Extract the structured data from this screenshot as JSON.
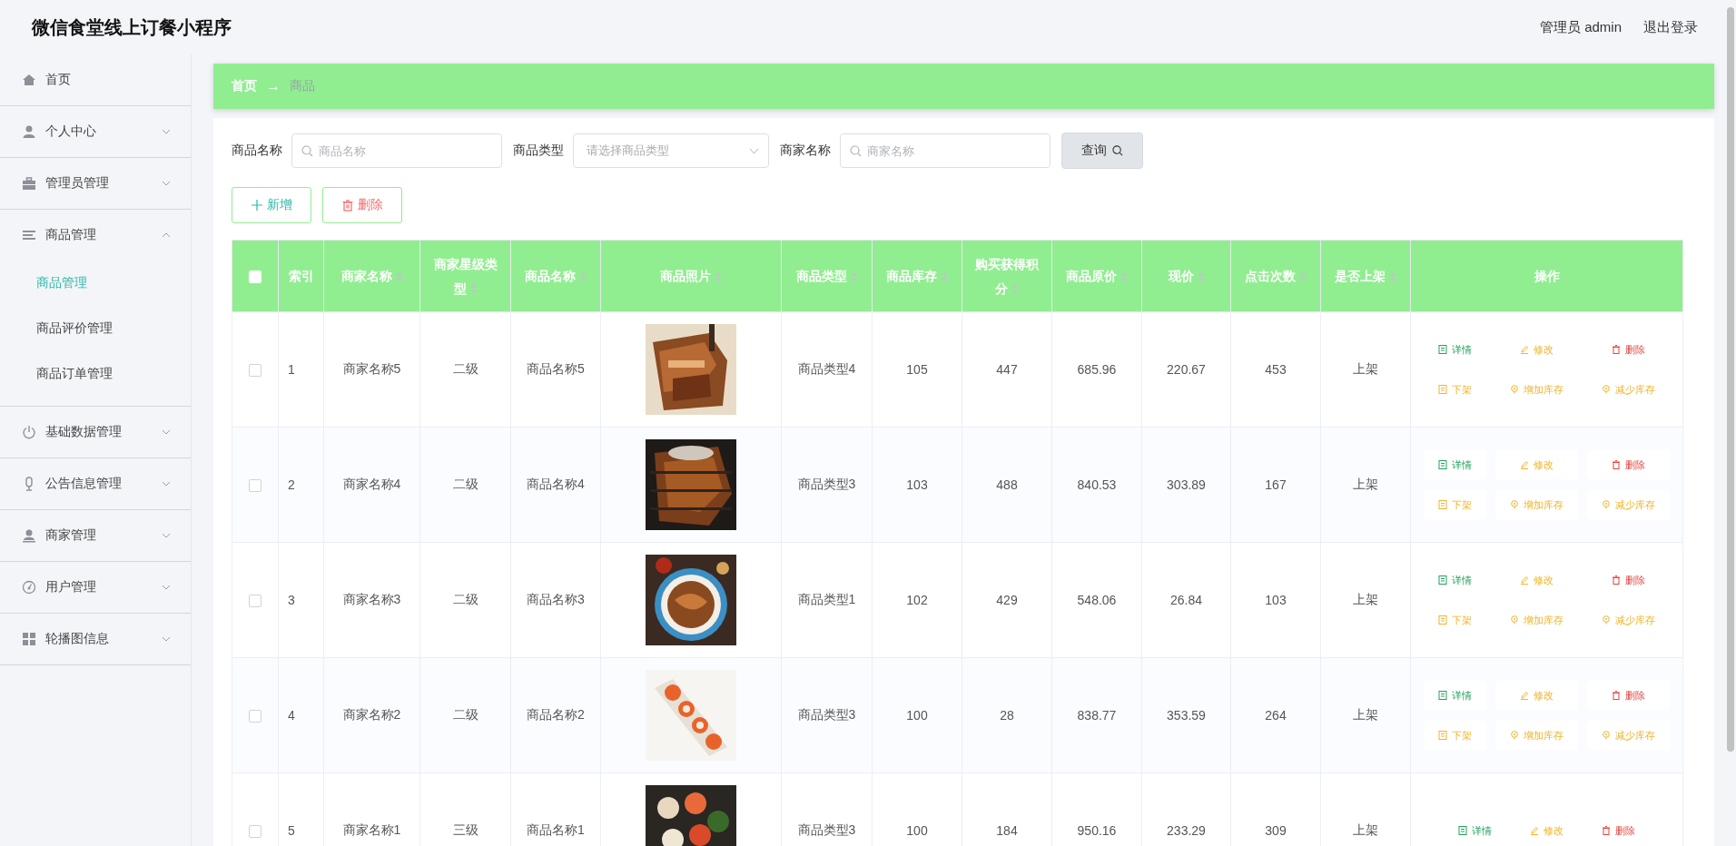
{
  "header": {
    "title": "微信食堂线上订餐小程序",
    "user": "管理员 admin",
    "logout": "退出登录"
  },
  "sidebar": {
    "items": [
      {
        "label": "首页",
        "expandable": false,
        "expanded": false
      },
      {
        "label": "个人中心",
        "expandable": true,
        "expanded": false
      },
      {
        "label": "管理员管理",
        "expandable": true,
        "expanded": false
      },
      {
        "label": "商品管理",
        "expandable": true,
        "expanded": true,
        "children": [
          {
            "label": "商品管理",
            "selected": true
          },
          {
            "label": "商品评价管理",
            "selected": false
          },
          {
            "label": "商品订单管理",
            "selected": false
          }
        ]
      },
      {
        "label": "基础数据管理",
        "expandable": true,
        "expanded": false
      },
      {
        "label": "公告信息管理",
        "expandable": true,
        "expanded": false
      },
      {
        "label": "商家管理",
        "expandable": true,
        "expanded": false
      },
      {
        "label": "用户管理",
        "expandable": true,
        "expanded": false
      },
      {
        "label": "轮播图信息",
        "expandable": true,
        "expanded": false
      }
    ]
  },
  "breadcrumb": {
    "items": [
      "首页",
      "商品"
    ],
    "separator": "→"
  },
  "search": {
    "fields": [
      {
        "label": "商品名称",
        "kind": "input",
        "placeholder": "商品名称"
      },
      {
        "label": "商品类型",
        "kind": "select",
        "placeholder": "请选择商品类型"
      },
      {
        "label": "商家名称",
        "kind": "input",
        "placeholder": "商家名称"
      }
    ],
    "button": "查询"
  },
  "toolbar": [
    {
      "label": "新增",
      "kind": "add"
    },
    {
      "label": "删除",
      "kind": "delete"
    }
  ],
  "table": {
    "columns": [
      {
        "kind": "checkbox",
        "checked": false
      },
      {
        "kind": "text",
        "label": "索引",
        "sortable": false
      },
      {
        "kind": "text",
        "label": "商家名称",
        "sortable": true
      },
      {
        "kind": "text",
        "label": "商家星级类型",
        "sortable": true
      },
      {
        "kind": "text",
        "label": "商品名称",
        "sortable": true
      },
      {
        "kind": "text",
        "label": "商品照片",
        "sortable": true
      },
      {
        "kind": "text",
        "label": "商品类型",
        "sortable": true
      },
      {
        "kind": "text",
        "label": "商品库存",
        "sortable": true
      },
      {
        "kind": "text",
        "label": "购买获得积分",
        "sortable": true
      },
      {
        "kind": "text",
        "label": "商品原价",
        "sortable": true
      },
      {
        "kind": "text",
        "label": "现价",
        "sortable": true
      },
      {
        "kind": "text",
        "label": "点击次数",
        "sortable": true
      },
      {
        "kind": "text",
        "label": "是否上架",
        "sortable": true
      },
      {
        "kind": "text",
        "label": "操作",
        "sortable": false
      }
    ],
    "rows": [
      {
        "cells": [
          {
            "kind": "checkbox",
            "checked": false
          },
          "1",
          "商家名称5",
          "二级",
          "商品名称5",
          {
            "kind": "picture"
          },
          "商品类型4",
          "105",
          "447",
          "685.96",
          "220.67",
          "453",
          "上架",
          {
            "kind": "actions",
            "actions": [
              {
                "label": "详情",
                "kind": "detail"
              },
              {
                "label": "修改",
                "kind": "edit"
              },
              {
                "label": "删除",
                "kind": "delete"
              },
              {
                "label": "下架",
                "kind": "offshelf"
              },
              {
                "label": "增加库存",
                "kind": "stock"
              },
              {
                "label": "减少库存",
                "kind": "stock"
              }
            ]
          }
        ]
      },
      {
        "cells": [
          {
            "kind": "checkbox",
            "checked": false
          },
          "2",
          "商家名称4",
          "二级",
          "商品名称4",
          {
            "kind": "picture"
          },
          "商品类型3",
          "103",
          "488",
          "840.53",
          "303.89",
          "167",
          "上架",
          {
            "kind": "actions",
            "actions": [
              {
                "label": "详情",
                "kind": "detail"
              },
              {
                "label": "修改",
                "kind": "edit"
              },
              {
                "label": "删除",
                "kind": "delete"
              },
              {
                "label": "下架",
                "kind": "offshelf"
              },
              {
                "label": "增加库存",
                "kind": "stock"
              },
              {
                "label": "减少库存",
                "kind": "stock"
              }
            ]
          }
        ]
      },
      {
        "cells": [
          {
            "kind": "checkbox",
            "checked": false
          },
          "3",
          "商家名称3",
          "二级",
          "商品名称3",
          {
            "kind": "picture"
          },
          "商品类型1",
          "102",
          "429",
          "548.06",
          "26.84",
          "103",
          "上架",
          {
            "kind": "actions",
            "actions": [
              {
                "label": "详情",
                "kind": "detail"
              },
              {
                "label": "修改",
                "kind": "edit"
              },
              {
                "label": "删除",
                "kind": "delete"
              },
              {
                "label": "下架",
                "kind": "offshelf"
              },
              {
                "label": "增加库存",
                "kind": "stock"
              },
              {
                "label": "减少库存",
                "kind": "stock"
              }
            ]
          }
        ]
      },
      {
        "cells": [
          {
            "kind": "checkbox",
            "checked": false
          },
          "4",
          "商家名称2",
          "二级",
          "商品名称2",
          {
            "kind": "picture"
          },
          "商品类型3",
          "100",
          "28",
          "838.77",
          "353.59",
          "264",
          "上架",
          {
            "kind": "actions",
            "actions": [
              {
                "label": "详情",
                "kind": "detail"
              },
              {
                "label": "修改",
                "kind": "edit"
              },
              {
                "label": "删除",
                "kind": "delete"
              },
              {
                "label": "下架",
                "kind": "offshelf"
              },
              {
                "label": "增加库存",
                "kind": "stock"
              },
              {
                "label": "减少库存",
                "kind": "stock"
              }
            ]
          }
        ]
      },
      {
        "cells": [
          {
            "kind": "checkbox",
            "checked": false
          },
          "5",
          "商家名称1",
          "三级",
          "商品名称1",
          {
            "kind": "picture"
          },
          "商品类型3",
          "100",
          "184",
          "950.16",
          "233.29",
          "309",
          "上架",
          {
            "kind": "actions",
            "actions": [
              {
                "label": "详情",
                "kind": "detail"
              },
              {
                "label": "修改",
                "kind": "edit"
              },
              {
                "label": "删除",
                "kind": "delete"
              }
            ]
          }
        ]
      }
    ]
  }
}
